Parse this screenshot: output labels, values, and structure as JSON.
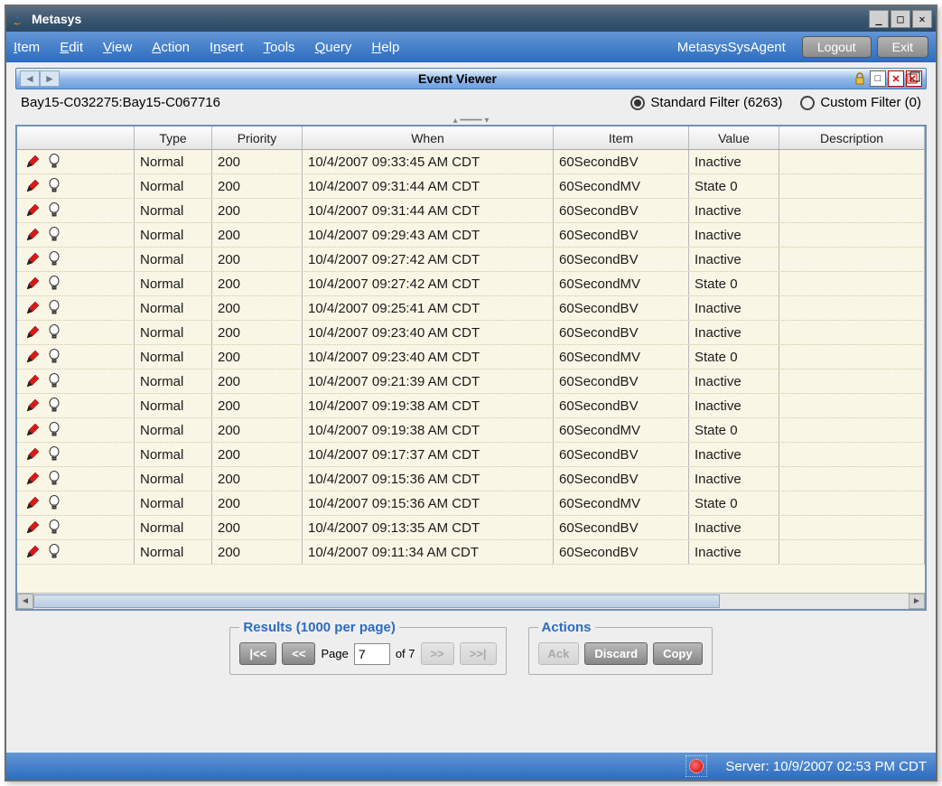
{
  "window": {
    "title": "Metasys"
  },
  "menubar": {
    "items": [
      "Item",
      "Edit",
      "View",
      "Action",
      "Insert",
      "Tools",
      "Query",
      "Help"
    ],
    "user": "MetasysSysAgent",
    "logout": "Logout",
    "exit": "Exit"
  },
  "panel": {
    "title": "Event Viewer",
    "breadcrumb": "Bay15-C032275:Bay15-C067716",
    "filters": {
      "standard_label": "Standard Filter (6263)",
      "custom_label": "Custom Filter (0)"
    }
  },
  "table": {
    "headers": {
      "type": "Type",
      "priority": "Priority",
      "when": "When",
      "item": "Item",
      "value": "Value",
      "description": "Description"
    },
    "rows": [
      {
        "type": "Normal",
        "priority": "200",
        "when": "10/4/2007 09:33:45 AM CDT",
        "item": "60SecondBV",
        "value": "Inactive",
        "description": ""
      },
      {
        "type": "Normal",
        "priority": "200",
        "when": "10/4/2007 09:31:44 AM CDT",
        "item": "60SecondMV",
        "value": "State 0",
        "description": ""
      },
      {
        "type": "Normal",
        "priority": "200",
        "when": "10/4/2007 09:31:44 AM CDT",
        "item": "60SecondBV",
        "value": "Inactive",
        "description": ""
      },
      {
        "type": "Normal",
        "priority": "200",
        "when": "10/4/2007 09:29:43 AM CDT",
        "item": "60SecondBV",
        "value": "Inactive",
        "description": ""
      },
      {
        "type": "Normal",
        "priority": "200",
        "when": "10/4/2007 09:27:42 AM CDT",
        "item": "60SecondBV",
        "value": "Inactive",
        "description": ""
      },
      {
        "type": "Normal",
        "priority": "200",
        "when": "10/4/2007 09:27:42 AM CDT",
        "item": "60SecondMV",
        "value": "State 0",
        "description": ""
      },
      {
        "type": "Normal",
        "priority": "200",
        "when": "10/4/2007 09:25:41 AM CDT",
        "item": "60SecondBV",
        "value": "Inactive",
        "description": ""
      },
      {
        "type": "Normal",
        "priority": "200",
        "when": "10/4/2007 09:23:40 AM CDT",
        "item": "60SecondBV",
        "value": "Inactive",
        "description": ""
      },
      {
        "type": "Normal",
        "priority": "200",
        "when": "10/4/2007 09:23:40 AM CDT",
        "item": "60SecondMV",
        "value": "State 0",
        "description": ""
      },
      {
        "type": "Normal",
        "priority": "200",
        "when": "10/4/2007 09:21:39 AM CDT",
        "item": "60SecondBV",
        "value": "Inactive",
        "description": ""
      },
      {
        "type": "Normal",
        "priority": "200",
        "when": "10/4/2007 09:19:38 AM CDT",
        "item": "60SecondBV",
        "value": "Inactive",
        "description": ""
      },
      {
        "type": "Normal",
        "priority": "200",
        "when": "10/4/2007 09:19:38 AM CDT",
        "item": "60SecondMV",
        "value": "State 0",
        "description": ""
      },
      {
        "type": "Normal",
        "priority": "200",
        "when": "10/4/2007 09:17:37 AM CDT",
        "item": "60SecondBV",
        "value": "Inactive",
        "description": ""
      },
      {
        "type": "Normal",
        "priority": "200",
        "when": "10/4/2007 09:15:36 AM CDT",
        "item": "60SecondBV",
        "value": "Inactive",
        "description": ""
      },
      {
        "type": "Normal",
        "priority": "200",
        "when": "10/4/2007 09:15:36 AM CDT",
        "item": "60SecondMV",
        "value": "State 0",
        "description": ""
      },
      {
        "type": "Normal",
        "priority": "200",
        "when": "10/4/2007 09:13:35 AM CDT",
        "item": "60SecondBV",
        "value": "Inactive",
        "description": ""
      },
      {
        "type": "Normal",
        "priority": "200",
        "when": "10/4/2007 09:11:34 AM CDT",
        "item": "60SecondBV",
        "value": "Inactive",
        "description": ""
      }
    ]
  },
  "results": {
    "legend": "Results (1000 per page)",
    "page_label": "Page",
    "page_value": "7",
    "of_label": "of 7",
    "first": "|<<",
    "prev": "<<",
    "next": ">>",
    "last": ">>|"
  },
  "actions": {
    "legend": "Actions",
    "ack": "Ack",
    "discard": "Discard",
    "copy": "Copy"
  },
  "statusbar": {
    "server": "Server: 10/9/2007 02:53 PM CDT"
  }
}
